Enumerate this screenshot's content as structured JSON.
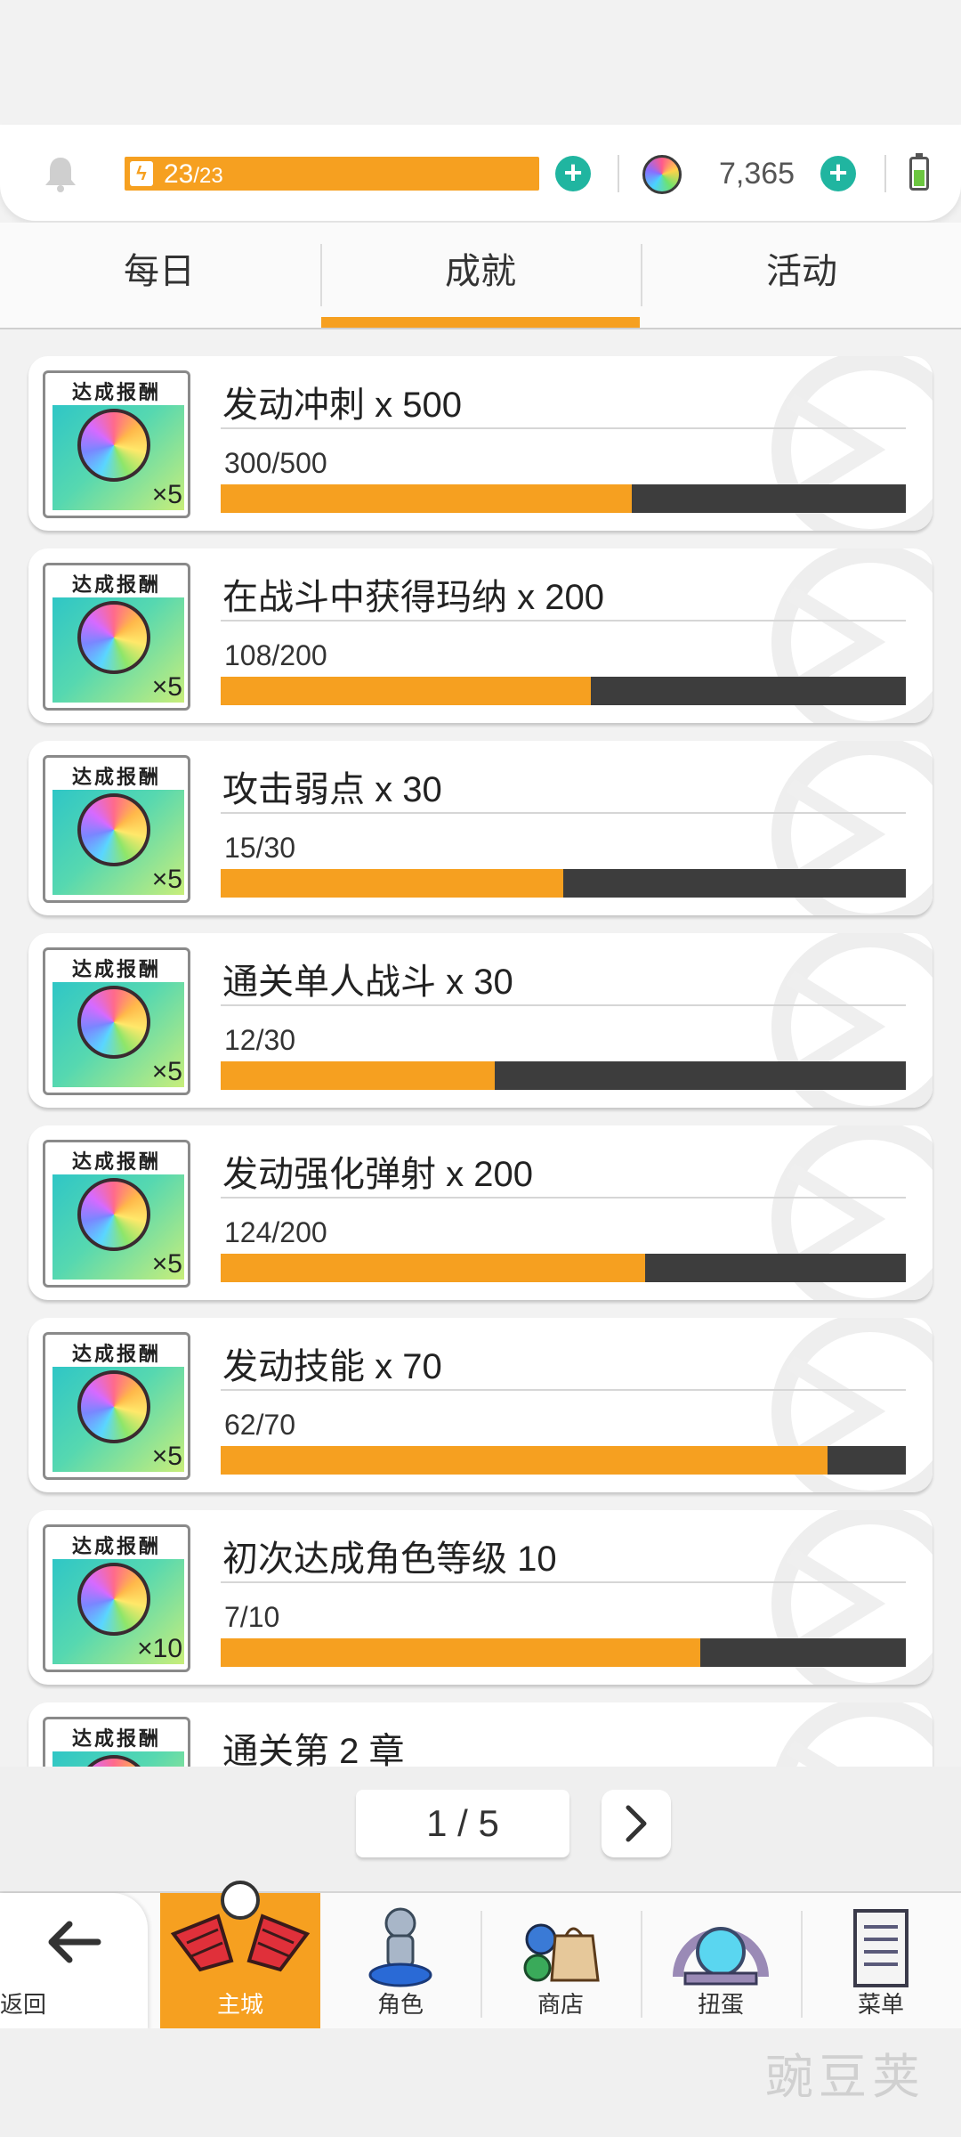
{
  "header": {
    "stamina_current": "23",
    "stamina_max": "/23",
    "gem_count": "7,365"
  },
  "tabs": [
    {
      "label": "每日"
    },
    {
      "label": "成就"
    },
    {
      "label": "活动"
    }
  ],
  "achievements": [
    {
      "title": "发动冲刺  x 500",
      "progress_text": "300/500",
      "progress": 0.6,
      "reward_label": "达成报酬",
      "reward_qty": "×5"
    },
    {
      "title": "在战斗中获得玛纳  x 200",
      "progress_text": "108/200",
      "progress": 0.54,
      "reward_label": "达成报酬",
      "reward_qty": "×5"
    },
    {
      "title": "攻击弱点  x 30",
      "progress_text": "15/30",
      "progress": 0.5,
      "reward_label": "达成报酬",
      "reward_qty": "×5"
    },
    {
      "title": "通关单人战斗  x 30",
      "progress_text": "12/30",
      "progress": 0.4,
      "reward_label": "达成报酬",
      "reward_qty": "×5"
    },
    {
      "title": "发动强化弹射  x 200",
      "progress_text": "124/200",
      "progress": 0.62,
      "reward_label": "达成报酬",
      "reward_qty": "×5"
    },
    {
      "title": "发动技能  x 70",
      "progress_text": "62/70",
      "progress": 0.886,
      "reward_label": "达成报酬",
      "reward_qty": "×5"
    },
    {
      "title": "初次达成角色等级 10",
      "progress_text": "7/10",
      "progress": 0.7,
      "reward_label": "达成报酬",
      "reward_qty": "×10"
    },
    {
      "title": "通关第 2 章",
      "progress_text": "",
      "progress": 0,
      "reward_label": "达成报酬",
      "reward_qty": ""
    }
  ],
  "pager": {
    "text": "1 / 5"
  },
  "nav": {
    "back": "返回",
    "items": [
      {
        "label": "主城",
        "icon": "wings-icon"
      },
      {
        "label": "角色",
        "icon": "character-icon"
      },
      {
        "label": "商店",
        "icon": "shop-bag-icon"
      },
      {
        "label": "扭蛋",
        "icon": "gacha-icon"
      },
      {
        "label": "菜单",
        "icon": "menu-list-icon"
      }
    ]
  },
  "watermark": "豌豆荚",
  "colors": {
    "accent": "#f6a020",
    "plus_button": "#20b5a0",
    "bar_background": "#3d3d3d"
  }
}
